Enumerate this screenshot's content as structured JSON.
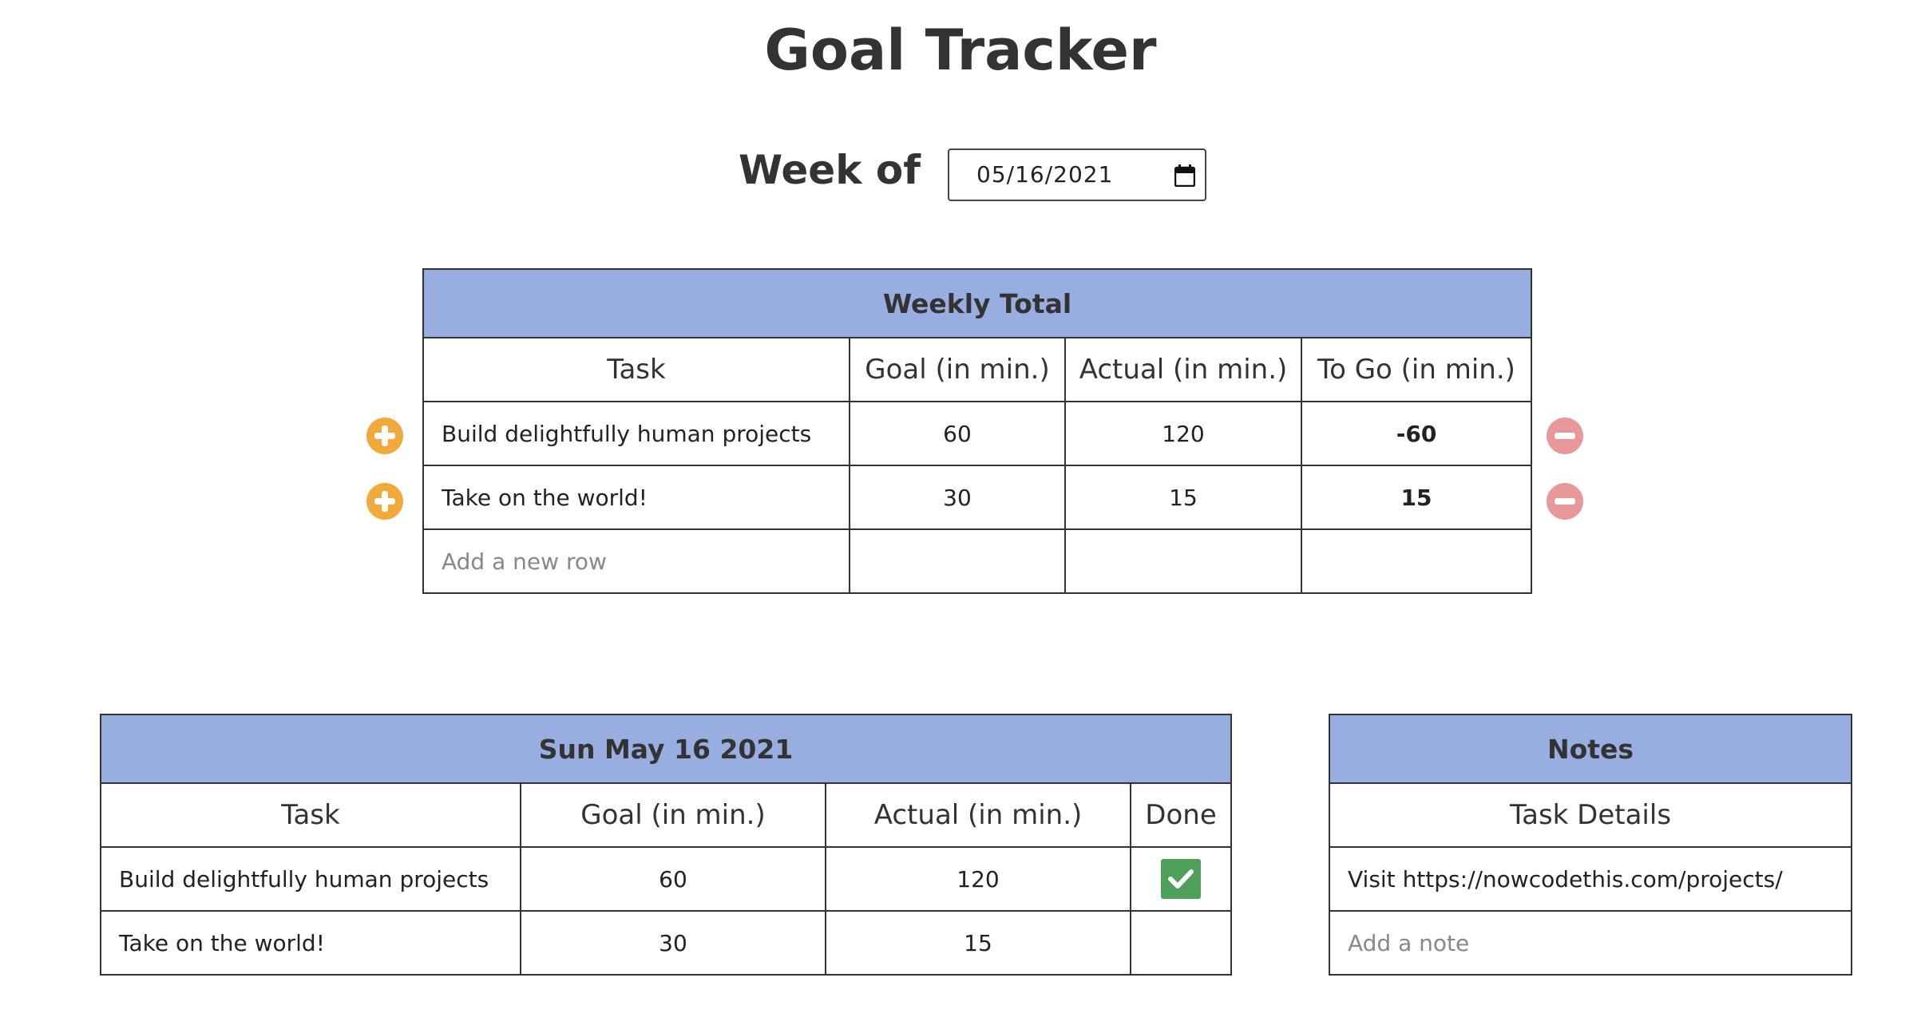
{
  "header": {
    "title": "Goal Tracker"
  },
  "week": {
    "label": "Week of",
    "date_value": "05/16/2021"
  },
  "weekly_table": {
    "title": "Weekly Total",
    "columns": [
      "Task",
      "Goal (in min.)",
      "Actual (in min.)",
      "To Go (in min.)"
    ],
    "rows": [
      {
        "task": "Build delightfully human projects",
        "goal": "60",
        "actual": "120",
        "to_go": "-60"
      },
      {
        "task": "Take on the world!",
        "goal": "30",
        "actual": "15",
        "to_go": "15"
      }
    ],
    "add_row_placeholder": "Add a new row"
  },
  "daily_table": {
    "title": "Sun May 16 2021",
    "columns": [
      "Task",
      "Goal (in min.)",
      "Actual (in min.)",
      "Done"
    ],
    "rows": [
      {
        "task": "Build delightfully human projects",
        "goal": "60",
        "actual": "120",
        "done": true
      },
      {
        "task": "Take on the world!",
        "goal": "30",
        "actual": "15",
        "done": false
      }
    ]
  },
  "notes_table": {
    "title": "Notes",
    "column": "Task Details",
    "rows": [
      "Visit https://nowcodethis.com/projects/"
    ],
    "add_note_placeholder": "Add a note"
  },
  "colors": {
    "header_bar": "#98aee0",
    "add_button": "#f0a93a",
    "remove_button": "#e89898",
    "negative_to_go": "#4ea05a",
    "positive_to_go": "#f03ef0",
    "done_check": "#4ea05a"
  },
  "icons": {
    "add_row": "plus-circle-icon",
    "remove_row": "minus-circle-icon",
    "calendar": "calendar-icon",
    "done": "checkmark-icon"
  }
}
